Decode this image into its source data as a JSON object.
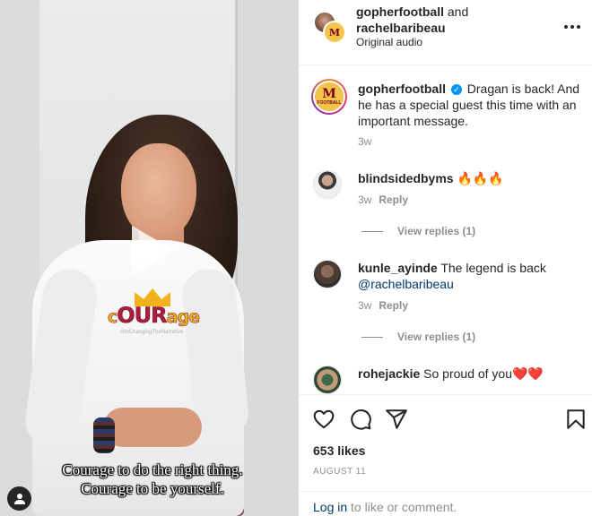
{
  "video": {
    "caption_line1": "Courage to do the right thing.",
    "caption_line2": "Courage to be yourself.",
    "shirt_logo_pre": "c",
    "shirt_logo_big": "OUR",
    "shirt_logo_post": "age",
    "shirt_logo_tag": "#ImChangingTheNarrative"
  },
  "header": {
    "user1": "gopherfootball",
    "joiner": "and",
    "user2": "rachelbaribeau",
    "audio": "Original audio"
  },
  "post": {
    "username": "gopherfootball",
    "caption": "Dragan is back! And he has a special guest this time with an important message.",
    "time": "3w"
  },
  "comments": [
    {
      "username": "blindsidedbyms",
      "text": "🔥🔥🔥",
      "time": "3w",
      "reply": "Reply",
      "view_replies": "View replies (1)"
    },
    {
      "username": "kunle_ayinde",
      "text": "The legend is back",
      "mention": "@rachelbaribeau",
      "time": "3w",
      "reply": "Reply",
      "view_replies": "View replies (1)"
    },
    {
      "username": "rohejackie",
      "text": "So proud of you❤️❤️"
    }
  ],
  "footer": {
    "likes": "653 likes",
    "date": "AUGUST 11",
    "login_link": "Log in",
    "login_rest": "to like or comment."
  },
  "colors": {
    "accent_link": "#00376b",
    "verified": "#0095f6",
    "muted": "#8e8e8e"
  }
}
